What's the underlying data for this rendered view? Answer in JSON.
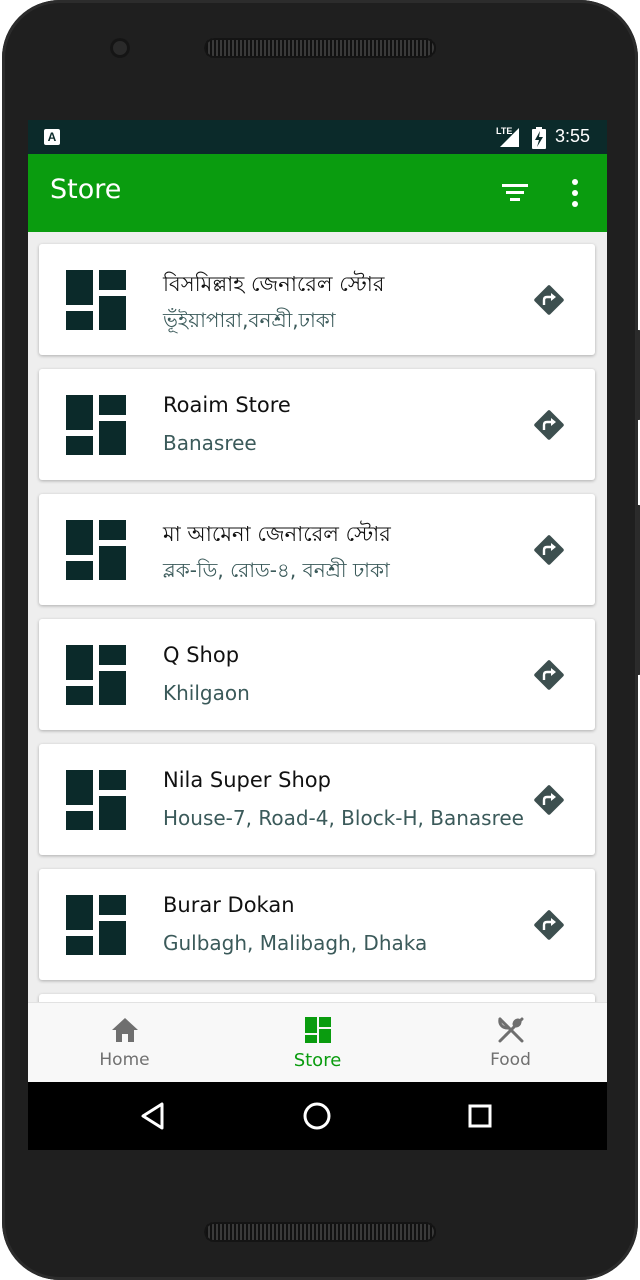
{
  "status_bar": {
    "app_badge": "A",
    "network": "LTE",
    "time": "3:55"
  },
  "app_bar": {
    "title": "Store",
    "filter_icon": "filter-icon",
    "more_icon": "more-vert-icon"
  },
  "stores": [
    {
      "name": "বিসমিল্লাহ জেনারেল স্টোর",
      "address": "ভূঁইয়াপারা,বনশ্রী,ঢাকা"
    },
    {
      "name": "Roaim Store",
      "address": "Banasree"
    },
    {
      "name": "মা আমেনা জেনারেল স্টোর",
      "address": "ব্লক-ডি, রোড-৪, বনশ্রী ঢাকা"
    },
    {
      "name": "Q Shop",
      "address": "Khilgaon"
    },
    {
      "name": "Nila Super Shop",
      "address": "House-7, Road-4, Block-H, Banasree"
    },
    {
      "name": "Burar Dokan",
      "address": "Gulbagh, Malibagh, Dhaka"
    }
  ],
  "bottom_nav": {
    "items": [
      {
        "label": "Home",
        "icon": "home-icon",
        "active": false
      },
      {
        "label": "Store",
        "icon": "dashboard-icon",
        "active": true
      },
      {
        "label": "Food",
        "icon": "restaurant-icon",
        "active": false
      }
    ]
  },
  "colors": {
    "primary": "#0a9c0f",
    "status_bar": "#0b2a2a",
    "store_icon": "#0b2a2a",
    "subtitle": "#3b5a5a"
  }
}
